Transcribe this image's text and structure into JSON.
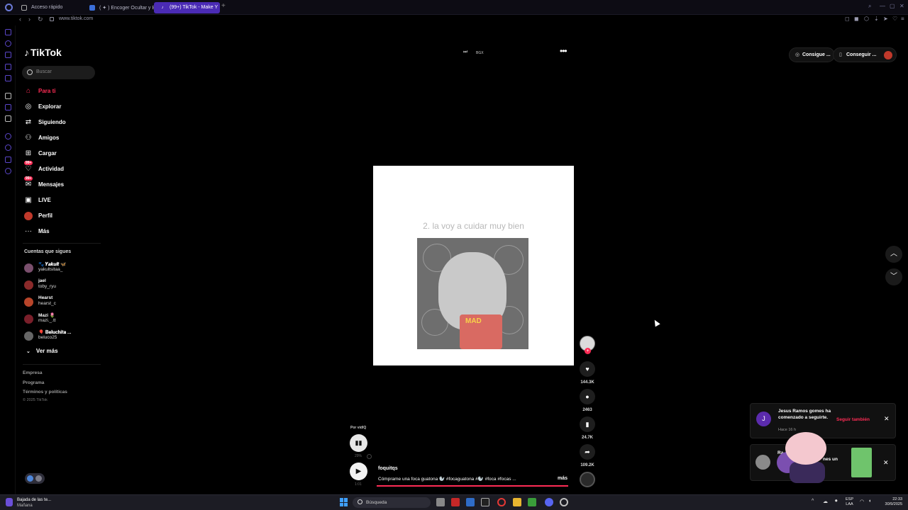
{
  "browser": {
    "tabs": [
      {
        "label": "Acceso rápido",
        "active": false
      },
      {
        "label": "( ✦ ) Encoger Ocultar y B",
        "active": false
      },
      {
        "label": "(99+) TikTok - Make Y",
        "active": true
      }
    ],
    "new_tab": "+",
    "url": "www.tiktok.com"
  },
  "tiktok": {
    "logo": "TikTok",
    "search_placeholder": "Buscar",
    "nav": [
      {
        "label": "Para ti",
        "icon": "home-icon",
        "active": true
      },
      {
        "label": "Explorar",
        "icon": "compass-icon"
      },
      {
        "label": "Siguiendo",
        "icon": "following-icon"
      },
      {
        "label": "Amigos",
        "icon": "friends-icon"
      },
      {
        "label": "Cargar",
        "icon": "upload-icon"
      },
      {
        "label": "Actividad",
        "icon": "activity-icon",
        "badge": "99+"
      },
      {
        "label": "Mensajes",
        "icon": "messages-icon",
        "badge": "99+"
      },
      {
        "label": "LIVE",
        "icon": "live-icon"
      },
      {
        "label": "Perfil",
        "icon": "profile-icon"
      },
      {
        "label": "Más",
        "icon": "more-icon"
      }
    ],
    "following_title": "Cuentas que sigues",
    "following": [
      {
        "name": "🐾 𝒀𝒂𝒌𝒖𝒍𝒕 🦋",
        "handle": "yakultsitaa_"
      },
      {
        "name": "jael",
        "handle": "toby_ryu"
      },
      {
        "name": "Hearst",
        "handle": "hearst_c"
      },
      {
        "name": "Mazi 🌷",
        "handle": "mazi._.tt"
      },
      {
        "name": "🎈 𝐁𝐞𝐥𝐮𝐜𝐡𝐢𝐭𝐚 ...",
        "handle": "beluco25"
      }
    ],
    "ver_mas": "Ver más",
    "footer": [
      "Empresa",
      "Programa",
      "Términos y políticas"
    ],
    "copyright": "© 2025 TikTok",
    "top_bar": {
      "speed": "BGX",
      "pill1": "Consigue ...",
      "pill2": "Conseguir ..."
    },
    "video": {
      "caption": "2. la voy a cuidar muy bien",
      "drink_label": "MAD"
    },
    "actions": {
      "likes": "144.3K",
      "comments": "2463",
      "saves": "24.7K",
      "shares": "109.2K"
    },
    "player": {
      "por": "Por vidIQ",
      "pct": "29%",
      "time": "1:01",
      "author": "foquitqs",
      "description": "Cómprame una foca guatona 🦭 #focaguatona #🦭 #foca #focas ...",
      "more": "más",
      "progress": 0.16
    },
    "notification1": {
      "avatar": "J",
      "text": "Jesus Ramos gomes ha comenzado a seguirte.",
      "time": "Hace 16 h",
      "action": "Seguir también"
    },
    "notification2": {
      "text_a": "Ra",
      "text_b": "nes un"
    }
  },
  "taskbar": {
    "weather_line1": "Bajada de las te...",
    "weather_line2": "Mañana",
    "search": "Búsqueda",
    "lang1": "ESP",
    "lang2": "LAA",
    "time": "22:33",
    "date": "30/9/2025"
  }
}
